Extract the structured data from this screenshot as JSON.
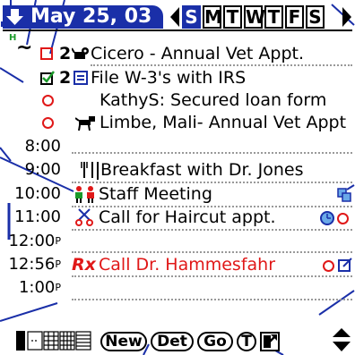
{
  "header": {
    "date_label": "May 25, 03",
    "weekdays": [
      "S",
      "M",
      "T",
      "W",
      "T",
      "F",
      "S"
    ],
    "selected_day_index": 0
  },
  "events": [
    {
      "text": "Cicero - Annual Vet Appt.",
      "priority": "2"
    },
    {
      "text": "File W-3's with IRS",
      "priority": "2"
    },
    {
      "text": "KathyS: Secured loan form"
    },
    {
      "text": "Limbe, Mali- Annual Vet Appt"
    }
  ],
  "times": [
    "8:00",
    "9:00",
    "10:00",
    "11:00",
    "12:00",
    "12:56",
    "1:00"
  ],
  "timed_events": {
    "breakfast": "Breakfast with Dr. Jones",
    "staff": "Staff Meeting",
    "haircut": "Call for Haircut appt.",
    "hammesfahr": "Call Dr. Hammesfahr"
  },
  "time_suffix": "P",
  "rx_label": "Rx",
  "toolbar": {
    "new_label": "New",
    "det_label": "Det",
    "go_label": "Go",
    "t_label": "T"
  },
  "colors": {
    "accent": "#1a2fa8",
    "alert": "#e01818"
  }
}
